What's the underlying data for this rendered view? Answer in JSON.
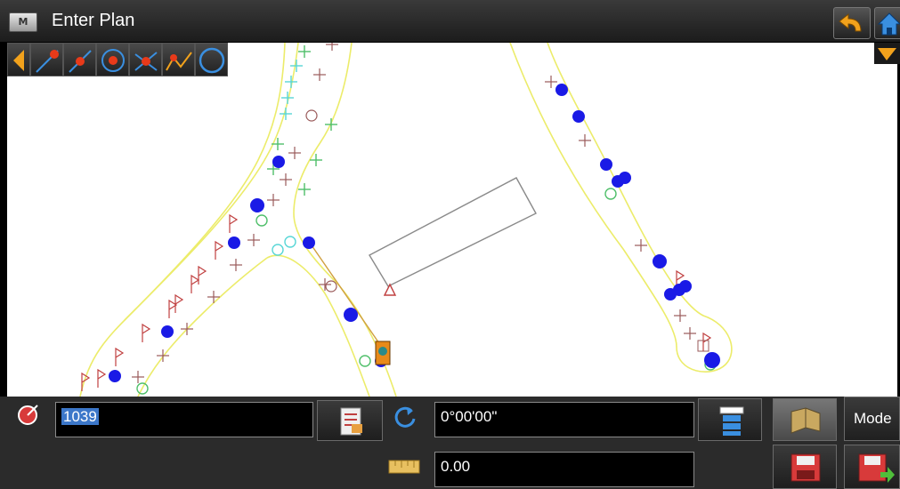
{
  "title_bar": {
    "app_icon_glyph": "M",
    "title": "Enter Plan"
  },
  "toolbar": {
    "tools": [
      {
        "icon": "back-arrow-icon"
      },
      {
        "icon": "line-point-icon"
      },
      {
        "icon": "two-point-line-icon"
      },
      {
        "icon": "circle-point-icon"
      },
      {
        "icon": "intersection-icon"
      },
      {
        "icon": "polyline-icon"
      },
      {
        "icon": "arc-icon"
      }
    ]
  },
  "bottom_panel": {
    "point_field_value": "1039",
    "angle_field_value": "0°00'00\"",
    "distance_field_value": "0.00",
    "mode_label": "Mode"
  },
  "colors": {
    "accent_yellow": "#f5f07a",
    "point_blue": "#1a1ae6",
    "selection_blue": "#3c77c9"
  }
}
